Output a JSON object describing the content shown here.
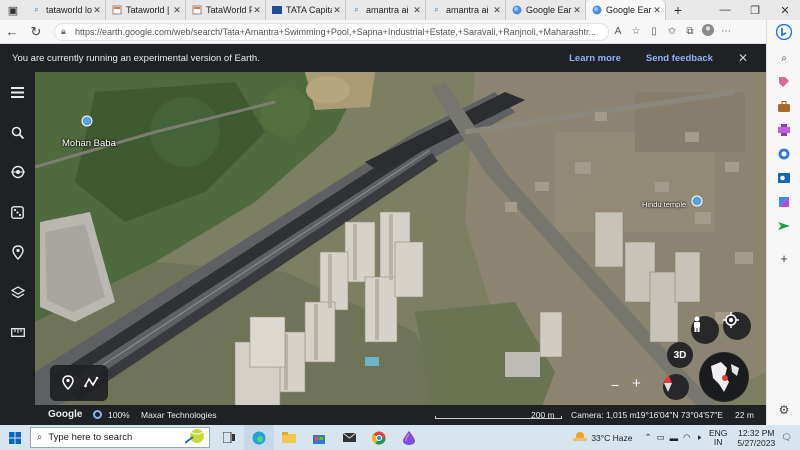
{
  "browser": {
    "tabs": [
      {
        "title": "tataworld lo",
        "icon": "search-icon",
        "active": false
      },
      {
        "title": "Tataworld |",
        "icon": "page-icon",
        "active": false
      },
      {
        "title": "TataWorld F",
        "icon": "page-icon",
        "active": false
      },
      {
        "title": "TATA Capita",
        "icon": "tata-icon",
        "active": false
      },
      {
        "title": "amantra ai",
        "icon": "search-icon",
        "active": false
      },
      {
        "title": "amantra ai",
        "icon": "search-icon",
        "active": false
      },
      {
        "title": "Google Ear",
        "icon": "earth-icon",
        "active": false
      },
      {
        "title": "Google Ear",
        "icon": "earth-icon",
        "active": true
      }
    ],
    "url": "https://earth.google.com/web/search/Tata+Amantra+Swimming+Pool,+Sapna+Industrial+Estate,+Saravali,+Ranjnoli,+Maharashtr...",
    "colors": {
      "tabbar": "#e8e8e8",
      "active_tab": "#f7f7f7"
    }
  },
  "banner": {
    "text": "You are currently running an experimental version of Earth.",
    "learn_more": "Learn more",
    "send_feedback": "Send feedback",
    "link_color": "#8ab4f8"
  },
  "left_rail": {
    "icons": [
      "menu-icon",
      "search-icon",
      "voyager-icon",
      "dice-icon",
      "pin-icon",
      "layers-icon",
      "ruler-icon"
    ]
  },
  "map": {
    "places": [
      {
        "name": "Mohan Baba"
      },
      {
        "name": "Hindu temple"
      }
    ],
    "view_3d_label": "3D",
    "zoom_out": "−",
    "zoom_in": "+"
  },
  "status_bar": {
    "brand": "Google",
    "load_percent": "100%",
    "attribution": "Maxar Technologies",
    "scale": "200 m",
    "camera": "Camera: 1,015 m",
    "coords": "19°16'04\"N 73°04'57\"E",
    "elevation": "22 m"
  },
  "sidebar": {
    "icons": [
      "bing-icon",
      "search-icon",
      "tag-icon",
      "briefcase-icon",
      "games-icon",
      "outlook-icon",
      "office-icon",
      "designer-icon",
      "send-icon",
      "add-icon",
      "settings-icon"
    ]
  },
  "taskbar": {
    "search_placeholder": "Type here to search",
    "weather": "33°C  Haze",
    "lang_top": "ENG",
    "lang_bottom": "IN",
    "time": "12:32 PM",
    "date": "5/27/2023"
  }
}
